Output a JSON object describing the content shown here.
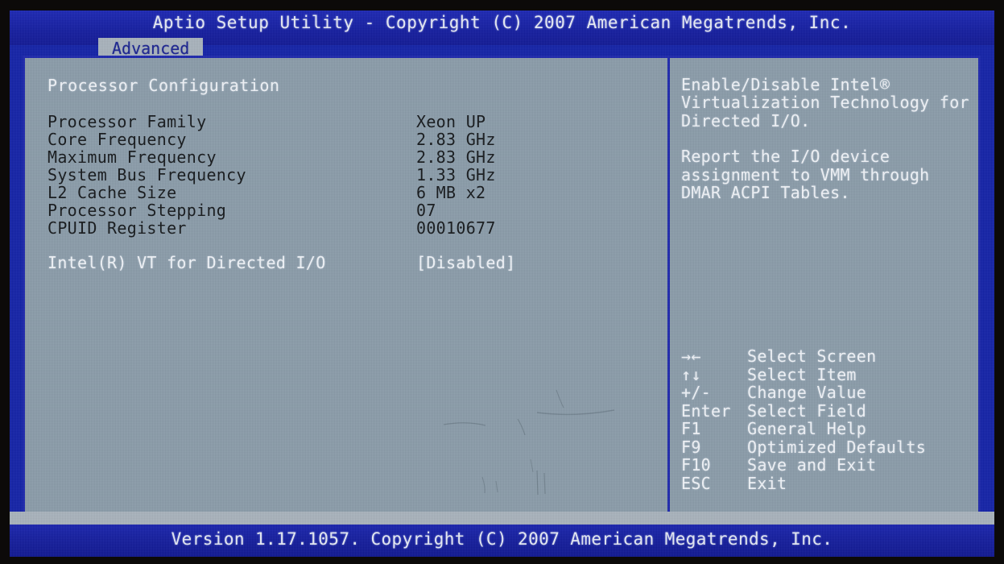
{
  "window": {
    "title": "Aptio Setup Utility - Copyright (C) 2007 American Megatrends, Inc.",
    "footer": "Version 1.17.1057. Copyright (C) 2007 American Megatrends, Inc."
  },
  "tabs": [
    {
      "label": "Advanced",
      "active": true
    }
  ],
  "main": {
    "section_header": "Processor Configuration",
    "info_items": [
      {
        "label": "Processor Family",
        "value": "Xeon UP"
      },
      {
        "label": "Core Frequency",
        "value": "2.83 GHz"
      },
      {
        "label": "Maximum Frequency",
        "value": "2.83 GHz"
      },
      {
        "label": "System Bus Frequency",
        "value": "1.33 GHz"
      },
      {
        "label": "L2 Cache Size",
        "value": "6 MB x2"
      },
      {
        "label": "Processor Stepping",
        "value": "07"
      },
      {
        "label": "CPUID Register",
        "value": "00010677"
      }
    ],
    "options": [
      {
        "label": "Intel(R) VT for Directed I/O",
        "value": "[Disabled]"
      }
    ]
  },
  "help": {
    "paragraphs": [
      "Enable/Disable Intel® Virtualization Technology for Directed I/O.",
      "Report the I/O device assignment to VMM through DMAR ACPI Tables."
    ]
  },
  "key_legend": [
    {
      "key": "→←",
      "action": "Select Screen"
    },
    {
      "key": "↑↓",
      "action": "Select Item"
    },
    {
      "key": "+/-",
      "action": "Change Value"
    },
    {
      "key": "Enter",
      "action": "Select Field"
    },
    {
      "key": "F1",
      "action": "General Help"
    },
    {
      "key": "F9",
      "action": "Optimized Defaults"
    },
    {
      "key": "F10",
      "action": "Save and Exit"
    },
    {
      "key": "ESC",
      "action": "Exit"
    }
  ],
  "colors": {
    "title_bar": "#151ea0",
    "panel_bg": "#8b9daa",
    "panel_border": "#1e28ad",
    "tab_bg": "#a9b3bd",
    "tab_text": "#1a2390",
    "bright_text": "#f1f4f9",
    "info_text": "#16191c",
    "bezel": "#0c0a09"
  }
}
